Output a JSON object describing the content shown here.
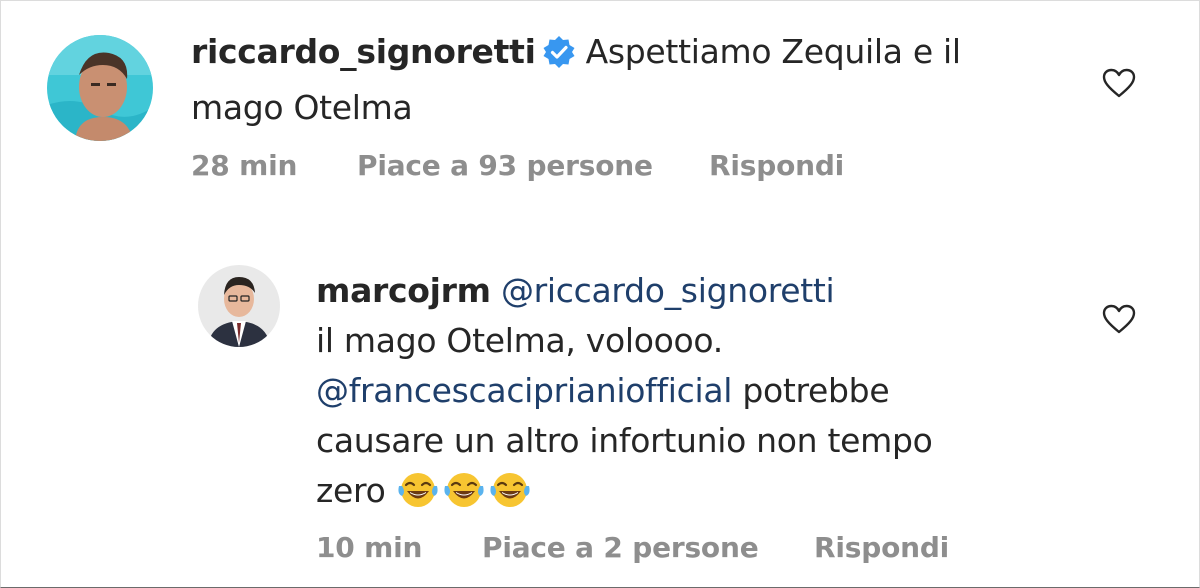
{
  "comments": [
    {
      "username": "riccardo_signoretti",
      "verified": true,
      "text_line1": "Aspettiamo Zequila e il",
      "text_line2": "mago Otelma",
      "time": "28 min",
      "likes": "Piace a 93 persone",
      "reply": "Rispondi",
      "icons": [
        "avatar",
        "verified-badge-icon",
        "heart-icon"
      ]
    },
    {
      "username": "marcojrm",
      "mention1": "@riccardo_signoretti",
      "text_line2": "il mago Otelma, voloooo.",
      "mention2": "@francescaciprianiofficial",
      "text_line3_rest": " potrebbe",
      "text_line4": "causare un altro infortunio non tempo",
      "text_line5": "zero",
      "emojis": [
        "😂",
        "😂",
        "😂"
      ],
      "time": "10 min",
      "likes": "Piace a 2 persone",
      "reply": "Rispondi",
      "icons": [
        "avatar",
        "laughing-crying-emoji-icon",
        "heart-icon"
      ]
    }
  ],
  "colors": {
    "text": "#262626",
    "meta": "#8e8e8e",
    "mention": "#1f3f6b",
    "verified": "#3897f0"
  }
}
